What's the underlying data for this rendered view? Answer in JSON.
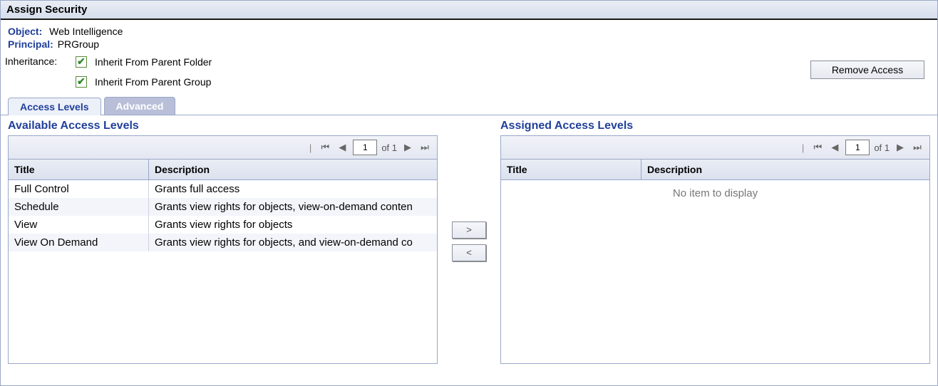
{
  "titlebar": "Assign Security",
  "meta": {
    "object_label": "Object:",
    "object_value": "Web Intelligence",
    "principal_label": "Principal:",
    "principal_value": "PRGroup"
  },
  "inheritance": {
    "label": "Inheritance:",
    "opt_folder": "Inherit From Parent Folder",
    "opt_group": "Inherit From Parent Group"
  },
  "buttons": {
    "remove_access": "Remove Access",
    "add": ">",
    "remove": "<"
  },
  "tabs": {
    "access_levels": "Access Levels",
    "advanced": "Advanced"
  },
  "pager": {
    "page": "1",
    "of_text_left": "of 1",
    "page_right": "1",
    "of_text_right": "of 1"
  },
  "available": {
    "title": "Available Access Levels",
    "col_title": "Title",
    "col_desc": "Description",
    "rows": [
      {
        "title": "Full Control",
        "desc": "Grants full access"
      },
      {
        "title": "Schedule",
        "desc": "Grants view rights for objects, view-on-demand conten"
      },
      {
        "title": "View",
        "desc": "Grants view rights for objects"
      },
      {
        "title": "View On Demand",
        "desc": "Grants view rights for objects, and view-on-demand co"
      }
    ]
  },
  "assigned": {
    "title": "Assigned Access Levels",
    "col_title": "Title",
    "col_desc": "Description",
    "empty": "No item to display"
  }
}
